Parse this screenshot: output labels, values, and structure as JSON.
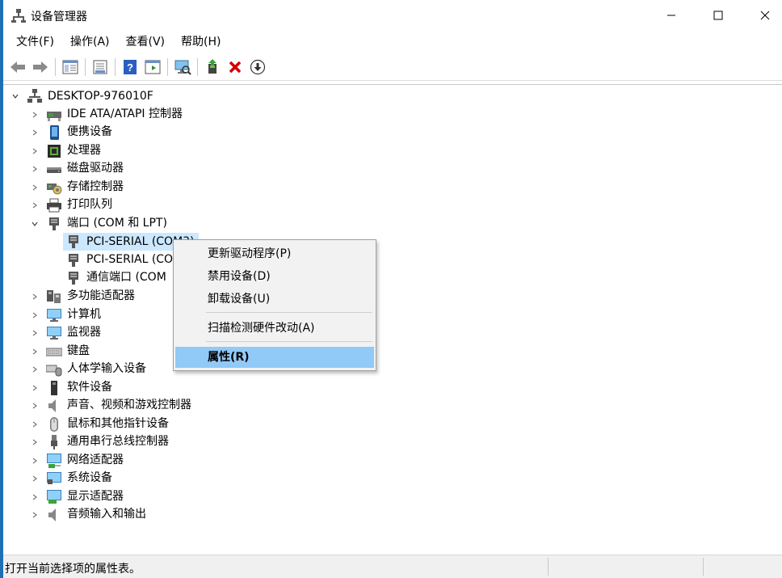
{
  "window": {
    "title": "设备管理器"
  },
  "menu": [
    "文件(F)",
    "操作(A)",
    "查看(V)",
    "帮助(H)"
  ],
  "toolbar": {
    "buttons": [
      "back-icon",
      "forward-icon",
      "show-hide-console-tree-icon",
      "properties-icon",
      "help-icon",
      "action-pane-icon",
      "scan-hardware-icon",
      "update-driver-icon",
      "uninstall-icon",
      "download-icon"
    ]
  },
  "tree": {
    "root": "DESKTOP-976010F",
    "categories": [
      {
        "label": "IDE ATA/ATAPI 控制器",
        "icon": "ide-controller-icon"
      },
      {
        "label": "便携设备",
        "icon": "portable-device-icon"
      },
      {
        "label": "处理器",
        "icon": "processor-icon"
      },
      {
        "label": "磁盘驱动器",
        "icon": "disk-drive-icon"
      },
      {
        "label": "存储控制器",
        "icon": "storage-controller-icon"
      },
      {
        "label": "打印队列",
        "icon": "printer-icon"
      },
      {
        "label": "端口 (COM 和 LPT)",
        "icon": "port-icon"
      },
      {
        "label": "多功能适配器",
        "icon": "multifunction-adapter-icon"
      },
      {
        "label": "计算机",
        "icon": "computer-icon"
      },
      {
        "label": "监视器",
        "icon": "monitor-icon"
      },
      {
        "label": "键盘",
        "icon": "keyboard-icon"
      },
      {
        "label": "人体学输入设备",
        "icon": "hid-icon"
      },
      {
        "label": "软件设备",
        "icon": "software-device-icon"
      },
      {
        "label": "声音、视频和游戏控制器",
        "icon": "sound-icon"
      },
      {
        "label": "鼠标和其他指针设备",
        "icon": "mouse-icon"
      },
      {
        "label": "通用串行总线控制器",
        "icon": "usb-icon"
      },
      {
        "label": "网络适配器",
        "icon": "network-adapter-icon"
      },
      {
        "label": "系统设备",
        "icon": "system-device-icon"
      },
      {
        "label": "显示适配器",
        "icon": "display-adapter-icon"
      },
      {
        "label": "音频输入和输出",
        "icon": "audio-io-icon"
      }
    ],
    "port_children": [
      "PCI-SERIAL (COM3)",
      "PCI-SERIAL (CO",
      "通信端口 (COM"
    ]
  },
  "context_menu": {
    "update_driver": "更新驱动程序(P)",
    "disable_device": "禁用设备(D)",
    "uninstall_device": "卸载设备(U)",
    "scan_hardware": "扫描检测硬件改动(A)",
    "properties": "属性(R)"
  },
  "status": {
    "text": "打开当前选择项的属性表。"
  },
  "colors": {
    "accent": "#1f6fb5",
    "selection": "#cce8ff",
    "menu_highlight": "#91c9f7",
    "delete_red": "#d40000"
  }
}
